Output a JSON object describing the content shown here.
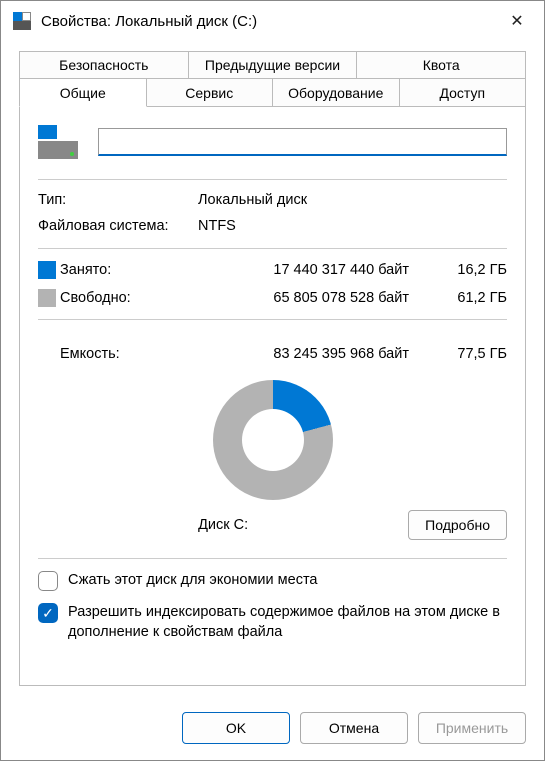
{
  "window": {
    "title": "Свойства: Локальный диск (C:)"
  },
  "tabs": {
    "row1": [
      "Безопасность",
      "Предыдущие версии",
      "Квота"
    ],
    "row2": [
      "Общие",
      "Сервис",
      "Оборудование",
      "Доступ"
    ],
    "active": "Общие"
  },
  "fields": {
    "name_value": "",
    "type_label": "Тип:",
    "type_value": "Локальный диск",
    "fs_label": "Файловая система:",
    "fs_value": "NTFS"
  },
  "space": {
    "used_label": "Занято:",
    "used_bytes": "17 440 317 440 байт",
    "used_gb": "16,2 ГБ",
    "free_label": "Свободно:",
    "free_bytes": "65 805 078 528 байт",
    "free_gb": "61,2 ГБ",
    "cap_label": "Емкость:",
    "cap_bytes": "83 245 395 968 байт",
    "cap_gb": "77,5 ГБ"
  },
  "chart_data": {
    "type": "pie",
    "categories": [
      "Занято",
      "Свободно"
    ],
    "values": [
      17440317440,
      65805078528
    ],
    "title": "Диск C:"
  },
  "disk_label": "Диск C:",
  "buttons": {
    "details": "Подробно",
    "ok": "OK",
    "cancel": "Отмена",
    "apply": "Применить"
  },
  "checks": {
    "compress_label": "Сжать этот диск для экономии места",
    "compress_checked": false,
    "index_label": "Разрешить индексировать содержимое файлов на этом диске в дополнение к свойствам файла",
    "index_checked": true
  }
}
